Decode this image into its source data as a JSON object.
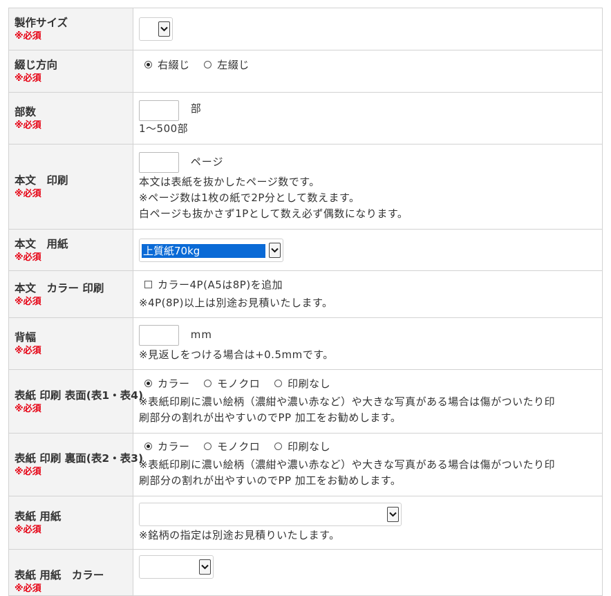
{
  "required_label": "※必須",
  "rows": {
    "size": {
      "label": "製作サイズ",
      "selected": ""
    },
    "binding": {
      "label": "綴じ方向",
      "options": [
        "右綴じ",
        "左綴じ"
      ],
      "selected_index": 0
    },
    "copies": {
      "label": "部数",
      "value": "",
      "unit": "部",
      "note": "1〜500部"
    },
    "body_print": {
      "label": "本文　印刷",
      "value": "",
      "unit": "ページ",
      "notes": [
        "本文は表紙を抜かしたページ数です。",
        "※ページ数は1枚の紙で2P分として数えます。",
        "白ページも抜かさず1Pとして数え必ず偶数になります。"
      ]
    },
    "body_paper": {
      "label": "本文　用紙",
      "selected": "上質紙70kg"
    },
    "body_color": {
      "label": "本文　カラー 印刷",
      "checkbox_label": "カラー4P(A5は8P)を追加",
      "checked": false,
      "note": "※4P(8P)以上は別途お見積いたします。"
    },
    "spine": {
      "label": "背幅",
      "value": "",
      "unit": "mm",
      "note": "※見返しをつける場合は+0.5mmです。"
    },
    "cover_front": {
      "label": "表紙 印刷 表面(表1・表4)",
      "options": [
        "カラー",
        "モノクロ",
        "印刷なし"
      ],
      "selected_index": 0,
      "notes": [
        "※表紙印刷に濃い絵柄（濃紺や濃い赤など）や大きな写真がある場合は傷がついたり印",
        "刷部分の割れが出やすいのでPP 加工をお勧めします。"
      ]
    },
    "cover_back": {
      "label": "表紙 印刷 裏面(表2・表3)",
      "options": [
        "カラー",
        "モノクロ",
        "印刷なし"
      ],
      "selected_index": 0,
      "notes": [
        "※表紙印刷に濃い絵柄（濃紺や濃い赤など）や大きな写真がある場合は傷がついたり印",
        "刷部分の割れが出やすいのでPP 加工をお勧めします。"
      ]
    },
    "cover_paper": {
      "label": "表紙 用紙",
      "selected": "",
      "note": "※銘柄の指定は別途お見積りいたします。"
    },
    "cover_paper_color": {
      "label": "表紙 用紙　カラー",
      "selected": ""
    }
  }
}
